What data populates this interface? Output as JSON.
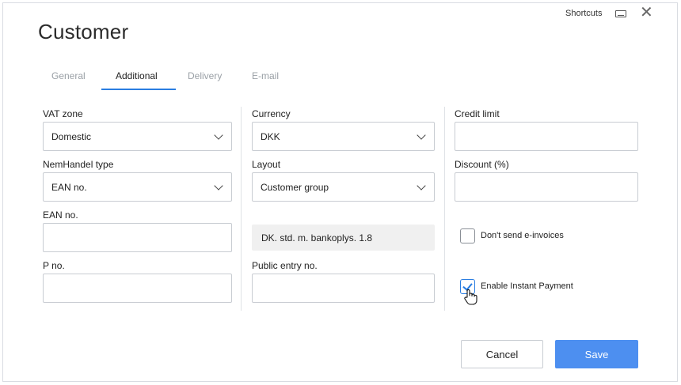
{
  "dialog": {
    "title": "Customer",
    "shortcuts_label": "Shortcuts",
    "close_icon": "close-icon",
    "keyboard_icon": "keyboard-icon"
  },
  "tabs": [
    {
      "label": "General",
      "active": false
    },
    {
      "label": "Additional",
      "active": true
    },
    {
      "label": "Delivery",
      "active": false
    },
    {
      "label": "E-mail",
      "active": false
    }
  ],
  "col1": {
    "vat_zone": {
      "label": "VAT zone",
      "value": "Domestic"
    },
    "nemhandel_type": {
      "label": "NemHandel type",
      "value": "EAN no."
    },
    "ean_no": {
      "label": "EAN no.",
      "value": ""
    },
    "p_no": {
      "label": "P no.",
      "value": ""
    }
  },
  "col2": {
    "currency": {
      "label": "Currency",
      "value": "DKK"
    },
    "layout": {
      "label": "Layout",
      "value": "Customer group"
    },
    "layout_info": "DK. std. m. bankoplys. 1.8",
    "public_entry_no": {
      "label": "Public entry no.",
      "value": ""
    }
  },
  "col3": {
    "credit_limit": {
      "label": "Credit limit",
      "value": ""
    },
    "discount": {
      "label": "Discount (%)",
      "value": ""
    },
    "dont_send_einvoices": {
      "label": "Don't send e-invoices",
      "checked": false
    },
    "enable_instant_payment": {
      "label": "Enable Instant Payment",
      "checked": true
    }
  },
  "footer": {
    "cancel_label": "Cancel",
    "save_label": "Save"
  },
  "colors": {
    "accent": "#2a7de1",
    "save_button": "#4d8ff0"
  }
}
